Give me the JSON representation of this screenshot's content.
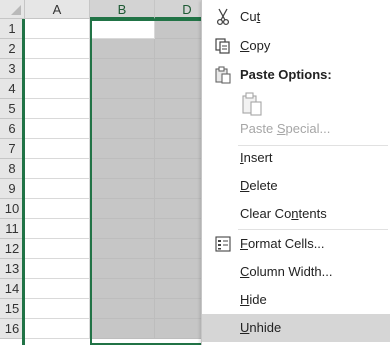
{
  "sheet": {
    "columns": [
      {
        "label": "A",
        "selected": false
      },
      {
        "label": "B",
        "selected": true
      },
      {
        "label": "D",
        "selected": true
      }
    ],
    "rows": [
      "1",
      "2",
      "3",
      "4",
      "5",
      "6",
      "7",
      "8",
      "9",
      "10",
      "11",
      "12",
      "13",
      "14",
      "15",
      "16"
    ],
    "colors": {
      "selection_fill": "#c6c6c6",
      "selection_border": "#217346",
      "header_bg": "#e6e6e6"
    }
  },
  "context_menu": {
    "cut": {
      "pre": "Cu",
      "key": "t",
      "post": "",
      "icon": "scissors-icon"
    },
    "copy": {
      "pre": "",
      "key": "C",
      "post": "opy",
      "icon": "copy-icon"
    },
    "paste_options": {
      "label": "Paste Options:",
      "icon": "paste-icon"
    },
    "paste_special": {
      "pre": "Paste ",
      "key": "S",
      "post": "pecial...",
      "disabled": true
    },
    "insert": {
      "pre": "",
      "key": "I",
      "post": "nsert"
    },
    "delete": {
      "pre": "",
      "key": "D",
      "post": "elete"
    },
    "clear_contents": {
      "pre": "Clear Co",
      "key": "n",
      "post": "tents"
    },
    "format_cells": {
      "pre": "",
      "key": "F",
      "post": "ormat Cells...",
      "icon": "format-cells-icon"
    },
    "column_width": {
      "pre": "",
      "key": "C",
      "post": "olumn Width..."
    },
    "hide": {
      "pre": "",
      "key": "H",
      "post": "ide"
    },
    "unhide": {
      "pre": "",
      "key": "U",
      "post": "nhide",
      "highlighted": true
    }
  }
}
